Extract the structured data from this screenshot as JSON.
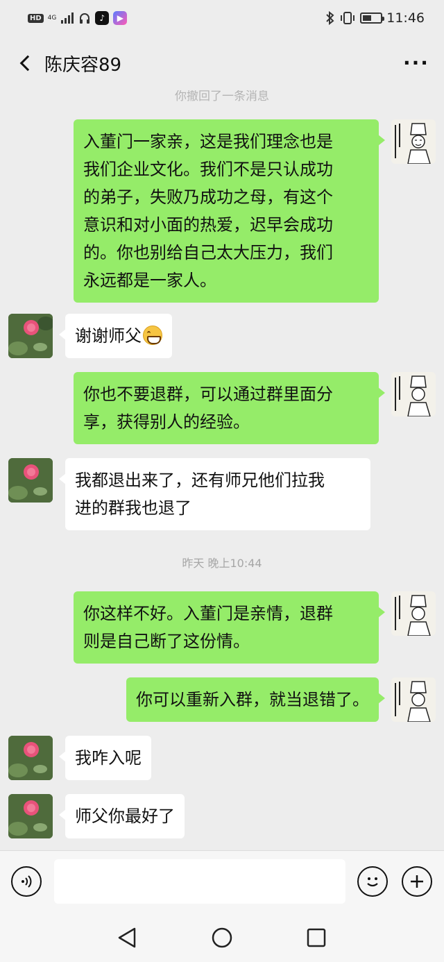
{
  "status_bar": {
    "network_badge": "HD",
    "network_type": "4G",
    "time": "11:46"
  },
  "header": {
    "title": "陈庆容89",
    "more_label": "···"
  },
  "chat": {
    "recall_notice": "你撤回了一条消息",
    "timestamp": "昨天 晚上10:44",
    "messages": [
      {
        "side": "self",
        "text": "入董门一家亲，这是我们理念也是\n我们企业文化。我们不是只认成功\n的弟子，失败乃成功之母，有这个\n意识和对小面的热爱，迟早会成功\n的。你也别给自己太大压力，我们\n永远都是一家人。"
      },
      {
        "side": "other",
        "text": "谢谢师父",
        "emoji": "grin-emoji"
      },
      {
        "side": "self",
        "text": "你也不要退群，可以通过群里面分\n享，获得别人的经验。"
      },
      {
        "side": "other",
        "text": "我都退出来了，还有师兄他们拉我\n进的群我也退了"
      },
      {
        "side": "self",
        "text": "你这样不好。入董门是亲情，退群\n则是自己断了这份情。"
      },
      {
        "side": "self",
        "text": "你可以重新入群，就当退错了。"
      },
      {
        "side": "other",
        "text": "我咋入呢"
      },
      {
        "side": "other",
        "text": "师父你最好了"
      }
    ]
  },
  "input_bar": {
    "voice_icon": "voice-icon",
    "emoji_icon": "emoji-icon",
    "plus_icon": "plus-icon",
    "value": ""
  },
  "colors": {
    "background": "#ededed",
    "self_bubble": "#95ec69",
    "other_bubble": "#ffffff"
  }
}
